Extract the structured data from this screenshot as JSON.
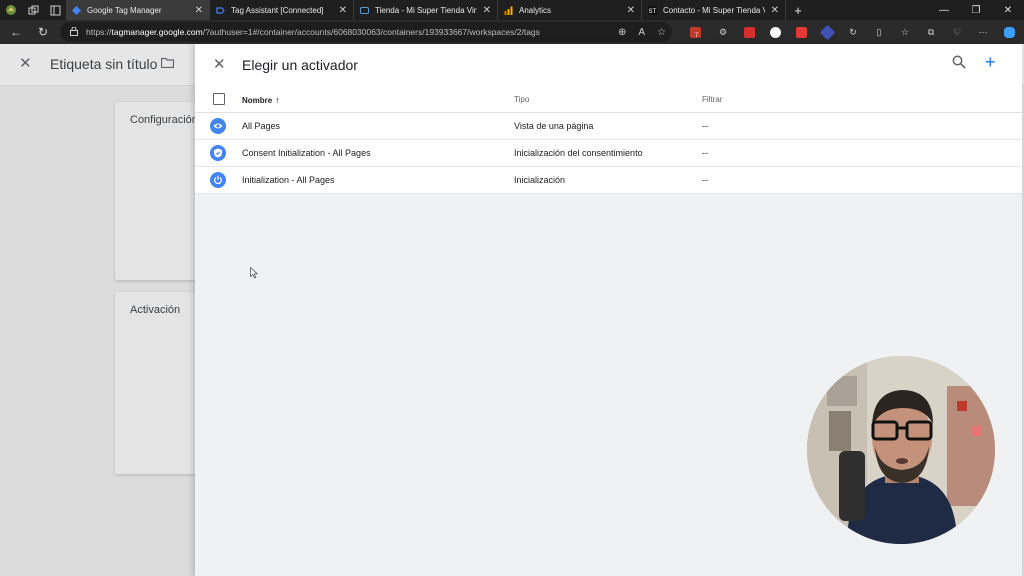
{
  "browser": {
    "tabs": [
      {
        "title": "Google Tag Manager",
        "active": true,
        "favicon_color": "#4285f4"
      },
      {
        "title": "Tag Assistant [Connected]",
        "active": false,
        "favicon_color": "#4285f4"
      },
      {
        "title": "Tienda - Mi Super Tienda Virtual",
        "active": false,
        "favicon_color": "#5c9bd6"
      },
      {
        "title": "Analytics",
        "active": false,
        "favicon_color": "#f9ab00"
      },
      {
        "title": "Contacto - Mi Super Tienda Virtual",
        "active": false,
        "favicon_color": "#111111"
      }
    ],
    "url_prefix": "https://",
    "url_host": "tagmanager.google.com",
    "url_path": "/?authuser=1#/container/accounts/6068030063/containers/193933667/workspaces/2/tags",
    "extension_badge": "7"
  },
  "background_page": {
    "tag_name": "Etiqueta sin título",
    "cards": [
      {
        "label": "Configuración"
      },
      {
        "label": "Activación"
      }
    ]
  },
  "panel": {
    "title": "Elegir un activador",
    "columns": {
      "name": "Nombre",
      "type": "Tipo",
      "filter": "Filtrar"
    },
    "rows": [
      {
        "name": "All Pages",
        "type": "Vista de una página",
        "filter": "--",
        "icon": "eye-icon"
      },
      {
        "name": "Consent Initialization - All Pages",
        "type": "Inicialización del consentimiento",
        "filter": "--",
        "icon": "shield-icon"
      },
      {
        "name": "Initialization - All Pages",
        "type": "Inicialización",
        "filter": "--",
        "icon": "power-icon"
      }
    ]
  },
  "colors": {
    "accent": "#1a73e8",
    "trigger_icon": "#4285f4",
    "panel_bg": "#eff1f3"
  }
}
